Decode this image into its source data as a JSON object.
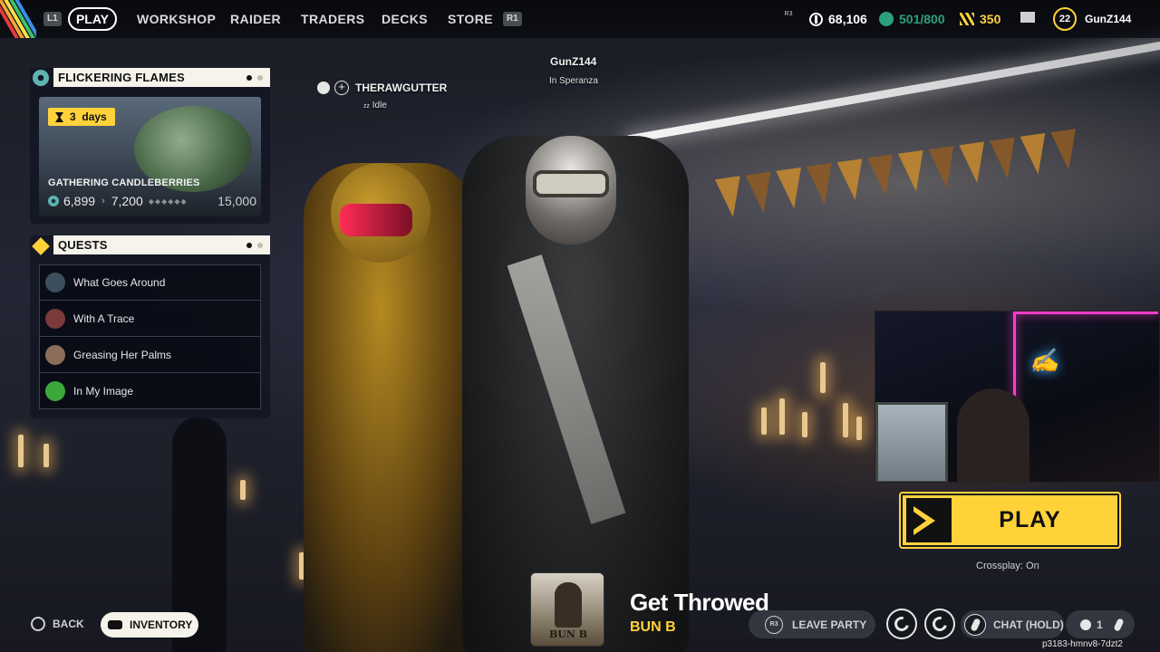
{
  "nav": {
    "left_key": "L1",
    "right_key": "R1",
    "tabs": [
      "PLAY",
      "WORKSHOP",
      "RAIDER",
      "TRADERS",
      "DECKS",
      "STORE"
    ],
    "active_tab": "PLAY"
  },
  "header": {
    "r3_label": "R3",
    "coins": "68,106",
    "credits": "501/800",
    "seeds": "350",
    "player_level": "22",
    "player_name": "GunZ144"
  },
  "event": {
    "title": "FLICKERING FLAMES",
    "time_left_value": "3",
    "time_left_unit": "days",
    "name": "GATHERING CANDLEBERRIES",
    "current": "6,899",
    "next": "7,200",
    "target": "15,000"
  },
  "quests": {
    "title": "QUESTS",
    "items": [
      {
        "label": "What Goes Around",
        "avatar_color": "#3d4f5c"
      },
      {
        "label": "With A Trace",
        "avatar_color": "#7a3a3a"
      },
      {
        "label": "Greasing Her Palms",
        "avatar_color": "#8a6e5a"
      },
      {
        "label": "In My Image",
        "avatar_color": "#3ba83b"
      }
    ]
  },
  "party": {
    "host_name": "GunZ144",
    "host_location": "In Speranza",
    "member_name": "THERAWGUTTER",
    "member_status": "Idle",
    "member_status_icon": "zz"
  },
  "play": {
    "label": "PLAY",
    "crossplay": "Crossplay: On"
  },
  "bottom": {
    "back_label": "BACK",
    "inventory_label": "INVENTORY",
    "leave_party_label": "LEAVE PARTY",
    "leave_party_key": "R3",
    "chat_label": "CHAT (HOLD)",
    "party_count": "1",
    "user_code": "p3183-hmnv8-7dzt2"
  },
  "music": {
    "song": "Get Throwed",
    "artist": "BUN B",
    "album_text": "BUN B"
  },
  "colors": {
    "accent": "#ffd23a",
    "panel_header": "#f5f3ea",
    "credits": "#2ba07b",
    "event_icon": "#5fb3b3"
  }
}
